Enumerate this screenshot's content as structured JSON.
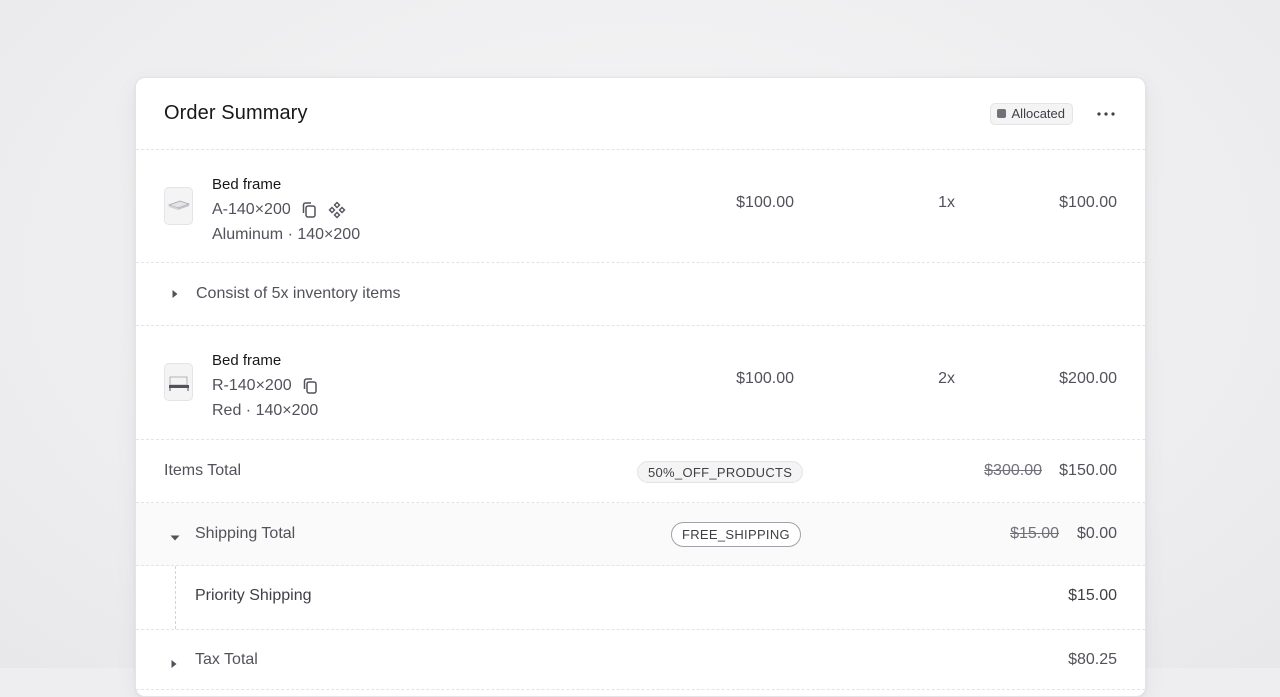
{
  "header": {
    "title": "Order Summary",
    "status": "Allocated"
  },
  "items": [
    {
      "name": "Bed frame",
      "sku": "A-140×200",
      "variant": "Aluminum · 140×200",
      "price": "$100.00",
      "quantity": "1x",
      "total": "$100.00"
    },
    {
      "name": "Bed frame",
      "sku": "R-140×200",
      "variant": "Red · 140×200",
      "price": "$100.00",
      "quantity": "2x",
      "total": "$200.00"
    }
  ],
  "inventory": {
    "label": "Consist of 5x inventory items"
  },
  "summary": {
    "items_total": {
      "label": "Items Total",
      "promo": "50%_OFF_PRODUCTS",
      "original": "$300.00",
      "value": "$150.00"
    },
    "shipping_total": {
      "label": "Shipping Total",
      "promo": "FREE_SHIPPING",
      "original": "$15.00",
      "value": "$0.00"
    },
    "shipping_method": {
      "label": "Priority Shipping",
      "value": "$15.00"
    },
    "tax_total": {
      "label": "Tax Total",
      "value": "$80.25"
    }
  },
  "colors": {
    "status_dot": "#71717a",
    "text_primary": "#18181b",
    "text_secondary": "#52525b"
  }
}
